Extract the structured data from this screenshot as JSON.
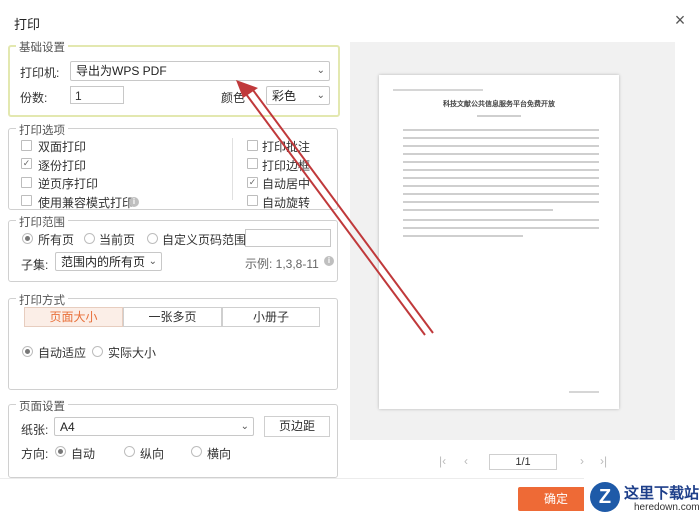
{
  "dialog": {
    "title": "打印",
    "close_symbol": "×"
  },
  "basic": {
    "group_title": "基础设置",
    "printer_label": "打印机:",
    "printer_value": "导出为WPS PDF",
    "copies_label": "份数:",
    "copies_value": "1",
    "color_label": "颜色",
    "color_value": "彩色"
  },
  "print_options": {
    "group_title": "打印选项",
    "left": [
      {
        "label": "双面打印",
        "checked": false
      },
      {
        "label": "逐份打印",
        "checked": true
      },
      {
        "label": "逆页序打印",
        "checked": false
      },
      {
        "label": "使用兼容模式打印",
        "checked": false
      }
    ],
    "right": [
      {
        "label": "打印批注",
        "checked": false
      },
      {
        "label": "打印边框",
        "checked": false
      },
      {
        "label": "自动居中",
        "checked": true
      },
      {
        "label": "自动旋转",
        "checked": false
      }
    ]
  },
  "print_range": {
    "group_title": "打印范围",
    "radios": [
      {
        "label": "所有页",
        "selected": true
      },
      {
        "label": "当前页",
        "selected": false
      },
      {
        "label": "自定义页码范围",
        "selected": false
      }
    ],
    "subset_label": "子集:",
    "subset_value": "范围内的所有页",
    "example": "示例: 1,3,8-11"
  },
  "print_mode": {
    "group_title": "打印方式",
    "tabs": [
      "页面大小",
      "一张多页",
      "小册子"
    ],
    "radios": [
      {
        "label": "自动适应",
        "selected": true
      },
      {
        "label": "实际大小",
        "selected": false
      }
    ]
  },
  "page_setup": {
    "group_title": "页面设置",
    "paper_label": "纸张:",
    "paper_value": "A4",
    "margins_button": "页边距",
    "orientation_label": "方向:",
    "orientation_options": [
      {
        "label": "自动",
        "selected": true
      },
      {
        "label": "纵向",
        "selected": false
      },
      {
        "label": "横向",
        "selected": false
      }
    ]
  },
  "preview": {
    "doc_title": "科技文献公共信息服务平台免费开放",
    "page_indicator": "1/1"
  },
  "footer": {
    "confirm_label": "确定"
  },
  "watermark": {
    "name": "这里下载站",
    "url": "heredown.com"
  },
  "colors": {
    "accent": "#ee6a36",
    "highlight_border": "#e3e8b0",
    "arrow": "#c0393b"
  }
}
